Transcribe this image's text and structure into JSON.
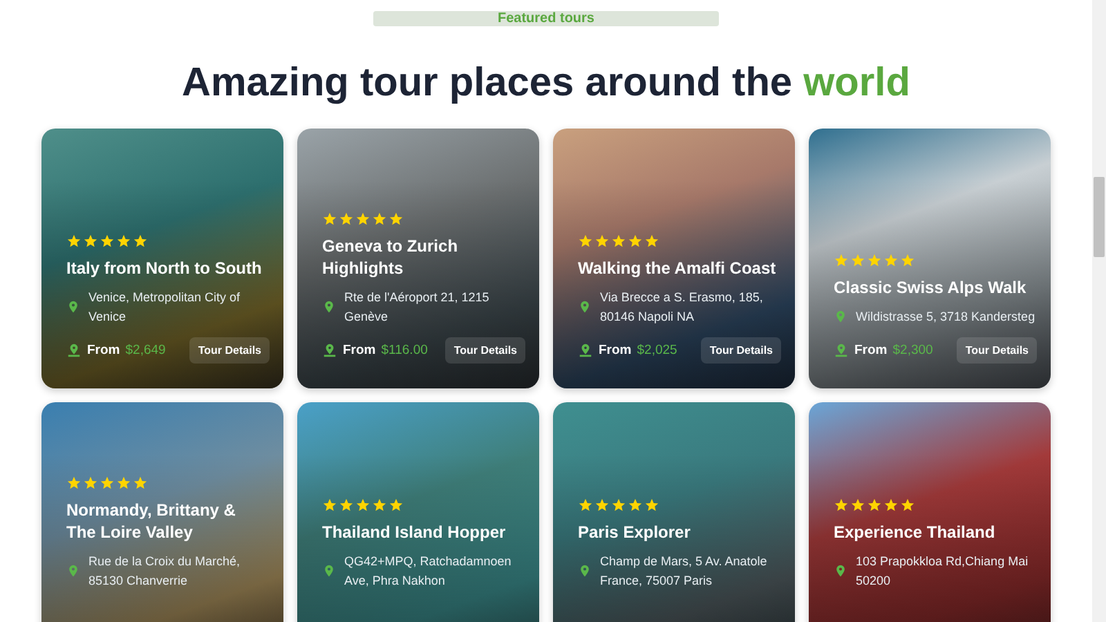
{
  "badge": "Featured tours",
  "heading": {
    "text": "Amazing tour places around the",
    "highlight": "world"
  },
  "tours": [
    {
      "title": "Italy from North to South",
      "stars": 5,
      "address": "Venice, Metropolitan City of Venice",
      "from": "From",
      "price": "$2,649",
      "button": "Tour Details"
    },
    {
      "title": "Geneva to Zurich Highlights",
      "stars": 5,
      "address": "Rte de l'Aéroport 21, 1215 Genève",
      "from": "From",
      "price": "$116.00",
      "button": "Tour Details"
    },
    {
      "title": "Walking the Amalfi Coast",
      "stars": 5,
      "address": "Via Brecce a S. Erasmo, 185, 80146 Napoli NA",
      "from": "From",
      "price": "$2,025",
      "button": "Tour Details"
    },
    {
      "title": "Classic Swiss Alps Walk",
      "stars": 5,
      "address": "Wildistrasse 5, 3718 Kandersteg",
      "from": "From",
      "price": "$2,300",
      "button": "Tour Details"
    },
    {
      "title": "Normandy, Brittany & The Loire Valley",
      "stars": 5,
      "address": "Rue de la Croix du Marché, 85130 Chanverrie"
    },
    {
      "title": "Thailand Island Hopper",
      "stars": 5,
      "address": "QG42+MPQ, Ratchadamnoen Ave, Phra Nakhon"
    },
    {
      "title": "Paris Explorer",
      "stars": 5,
      "address": "Champ de Mars, 5 Av. Anatole France, 75007 Paris"
    },
    {
      "title": "Experience Thailand",
      "stars": 5,
      "address": "103 Prapokkloa Rd,Chiang Mai 50200"
    }
  ]
}
